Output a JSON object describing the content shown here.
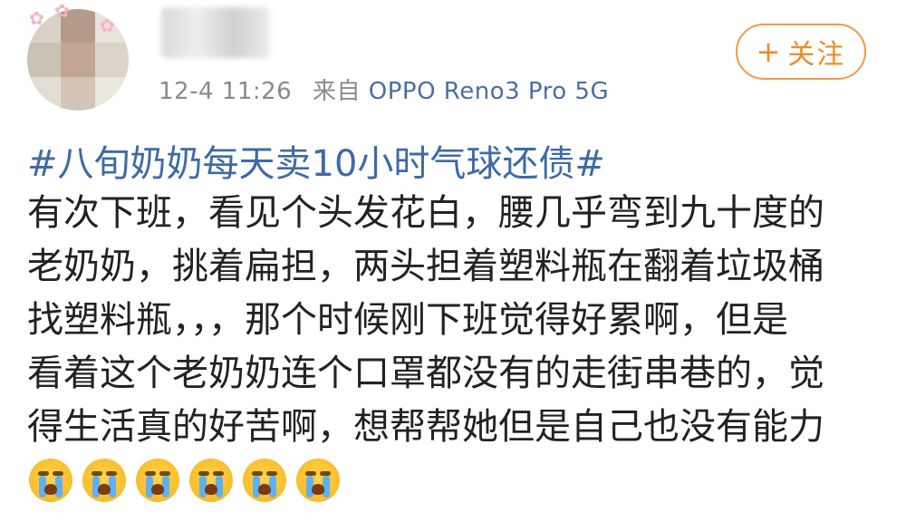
{
  "post": {
    "time": "12-4 11:26",
    "source_prefix": "来自",
    "source_device": "OPPO Reno3 Pro 5G",
    "follow_label": "关注",
    "follow_plus": "+",
    "hashtag": "#八旬奶奶每天卖10小时气球还债#",
    "lines": [
      "有次下班，看见个头发花白，腰几乎弯到九十度的",
      "老奶奶，挑着扁担，两头担着塑料瓶在翻着垃圾桶",
      "找塑料瓶，，，那个时候刚下班觉得好累啊，但是",
      "看着这个老奶奶连个口罩都没有的走街串巷的，觉",
      "得生活真的好苦啊，想帮帮她但是自己也没有能力"
    ],
    "emojis": [
      "crying-face",
      "crying-face",
      "crying-face",
      "crying-face",
      "crying-face",
      "crying-face"
    ]
  },
  "colors": {
    "hashtag": "#3f6aa7",
    "source": "#4a6fa5",
    "follow_accent": "#f08a24",
    "meta_gray": "#8a8a8a"
  }
}
